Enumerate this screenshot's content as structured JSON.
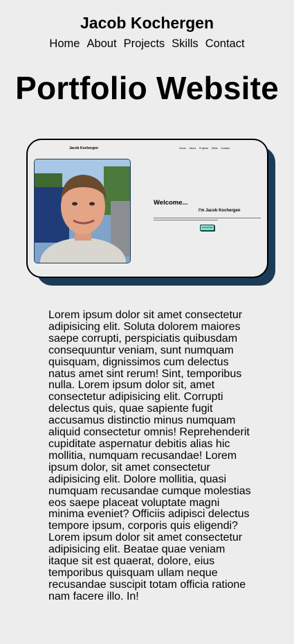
{
  "header": {
    "site_title": "Jacob Kochergen",
    "nav": [
      "Home",
      "About",
      "Projects",
      "Skills",
      "Contact"
    ]
  },
  "main": {
    "page_title": "Portfolio Website",
    "preview": {
      "brand": "Jacob Kochergen",
      "nav": [
        "Home",
        "About",
        "Projects",
        "Skills",
        "Contact"
      ],
      "welcome": "Welcome...",
      "name": "I'm Jacob Kochergen",
      "button": "Contact Me"
    },
    "description": "Lorem ipsum dolor sit amet consectetur adipisicing elit. Soluta dolorem maiores saepe corrupti, perspiciatis quibusdam consequuntur veniam, sunt numquam quisquam, dignissimos cum delectus natus amet sint rerum! Sint, temporibus nulla. Lorem ipsum dolor sit, amet consectetur adipisicing elit. Corrupti delectus quis, quae sapiente fugit accusamus distinctio minus numquam aliquid consectetur omnis! Reprehenderit cupiditate aspernatur debitis alias hic mollitia, numquam recusandae! Lorem ipsum dolor, sit amet consectetur adipisicing elit. Dolore mollitia, quasi numquam recusandae cumque molestias eos saepe placeat voluptate magni minima eveniet? Officiis adipisci delectus tempore ipsum, corporis quis eligendi? Lorem ipsum dolor sit amet consectetur adipisicing elit. Beatae quae veniam itaque sit est quaerat, dolore, eius temporibus quisquam ullam neque recusandae suscipit totam officia ratione nam facere illo. In!"
  },
  "colors": {
    "background": "#ededee",
    "shadow": "#1b3b57",
    "button": "#7ee8c0"
  }
}
